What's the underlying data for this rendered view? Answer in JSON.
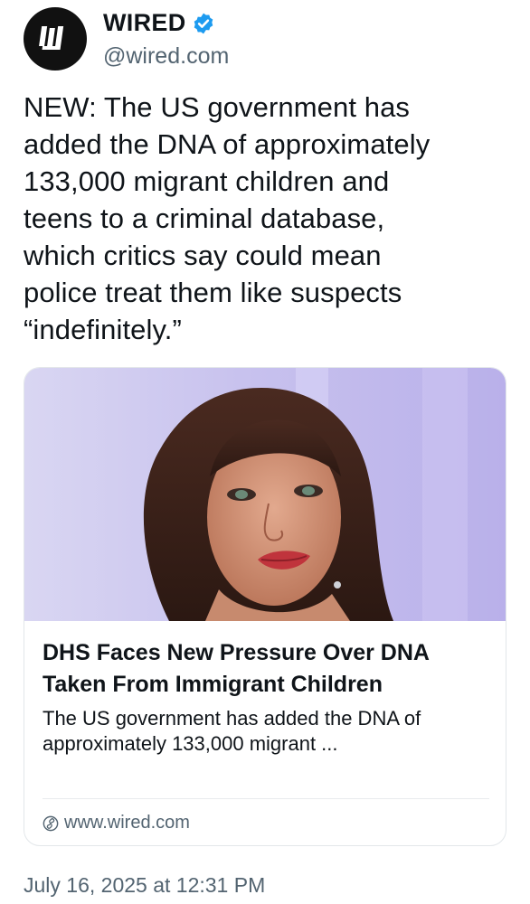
{
  "author": {
    "display_name": "WIRED",
    "handle": "@wired.com",
    "avatar_icon": "wired-logo-icon",
    "verified_icon": "verified-badge-icon",
    "verified_color": "#1d9bf0"
  },
  "tweet": {
    "text_lines": [
      "NEW: The US government has",
      "added the DNA of approximately",
      "133,000 migrant children and",
      "teens to a criminal database,",
      "which critics say could mean",
      "police treat them like suspects",
      "“indefinitely.”"
    ],
    "timestamp": "July 16, 2025 at 12:31 PM"
  },
  "link_card": {
    "title": "DHS Faces New Pressure Over DNA Taken From Immigrant Children",
    "description": "The US government has added the DNA of approximately 133,000 migrant ...",
    "domain": "www.wired.com",
    "domain_icon": "link-icon"
  },
  "colors": {
    "text_primary": "#0f1419",
    "text_secondary": "#536471",
    "image_background": "#c9c4ef"
  }
}
